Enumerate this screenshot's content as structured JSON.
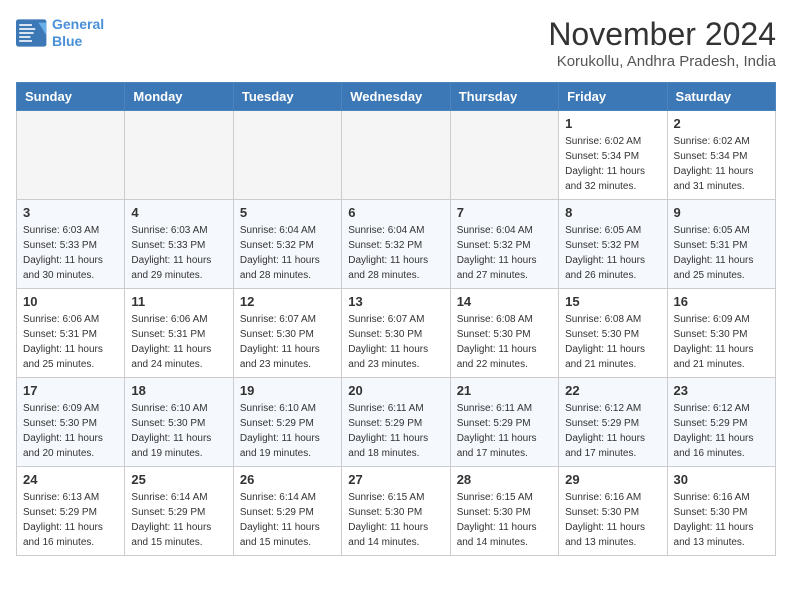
{
  "header": {
    "logo_line1": "General",
    "logo_line2": "Blue",
    "month": "November 2024",
    "location": "Korukollu, Andhra Pradesh, India"
  },
  "days_of_week": [
    "Sunday",
    "Monday",
    "Tuesday",
    "Wednesday",
    "Thursday",
    "Friday",
    "Saturday"
  ],
  "weeks": [
    [
      {
        "day": "",
        "info": ""
      },
      {
        "day": "",
        "info": ""
      },
      {
        "day": "",
        "info": ""
      },
      {
        "day": "",
        "info": ""
      },
      {
        "day": "",
        "info": ""
      },
      {
        "day": "1",
        "info": "Sunrise: 6:02 AM\nSunset: 5:34 PM\nDaylight: 11 hours and 32 minutes."
      },
      {
        "day": "2",
        "info": "Sunrise: 6:02 AM\nSunset: 5:34 PM\nDaylight: 11 hours and 31 minutes."
      }
    ],
    [
      {
        "day": "3",
        "info": "Sunrise: 6:03 AM\nSunset: 5:33 PM\nDaylight: 11 hours and 30 minutes."
      },
      {
        "day": "4",
        "info": "Sunrise: 6:03 AM\nSunset: 5:33 PM\nDaylight: 11 hours and 29 minutes."
      },
      {
        "day": "5",
        "info": "Sunrise: 6:04 AM\nSunset: 5:32 PM\nDaylight: 11 hours and 28 minutes."
      },
      {
        "day": "6",
        "info": "Sunrise: 6:04 AM\nSunset: 5:32 PM\nDaylight: 11 hours and 28 minutes."
      },
      {
        "day": "7",
        "info": "Sunrise: 6:04 AM\nSunset: 5:32 PM\nDaylight: 11 hours and 27 minutes."
      },
      {
        "day": "8",
        "info": "Sunrise: 6:05 AM\nSunset: 5:32 PM\nDaylight: 11 hours and 26 minutes."
      },
      {
        "day": "9",
        "info": "Sunrise: 6:05 AM\nSunset: 5:31 PM\nDaylight: 11 hours and 25 minutes."
      }
    ],
    [
      {
        "day": "10",
        "info": "Sunrise: 6:06 AM\nSunset: 5:31 PM\nDaylight: 11 hours and 25 minutes."
      },
      {
        "day": "11",
        "info": "Sunrise: 6:06 AM\nSunset: 5:31 PM\nDaylight: 11 hours and 24 minutes."
      },
      {
        "day": "12",
        "info": "Sunrise: 6:07 AM\nSunset: 5:30 PM\nDaylight: 11 hours and 23 minutes."
      },
      {
        "day": "13",
        "info": "Sunrise: 6:07 AM\nSunset: 5:30 PM\nDaylight: 11 hours and 23 minutes."
      },
      {
        "day": "14",
        "info": "Sunrise: 6:08 AM\nSunset: 5:30 PM\nDaylight: 11 hours and 22 minutes."
      },
      {
        "day": "15",
        "info": "Sunrise: 6:08 AM\nSunset: 5:30 PM\nDaylight: 11 hours and 21 minutes."
      },
      {
        "day": "16",
        "info": "Sunrise: 6:09 AM\nSunset: 5:30 PM\nDaylight: 11 hours and 21 minutes."
      }
    ],
    [
      {
        "day": "17",
        "info": "Sunrise: 6:09 AM\nSunset: 5:30 PM\nDaylight: 11 hours and 20 minutes."
      },
      {
        "day": "18",
        "info": "Sunrise: 6:10 AM\nSunset: 5:30 PM\nDaylight: 11 hours and 19 minutes."
      },
      {
        "day": "19",
        "info": "Sunrise: 6:10 AM\nSunset: 5:29 PM\nDaylight: 11 hours and 19 minutes."
      },
      {
        "day": "20",
        "info": "Sunrise: 6:11 AM\nSunset: 5:29 PM\nDaylight: 11 hours and 18 minutes."
      },
      {
        "day": "21",
        "info": "Sunrise: 6:11 AM\nSunset: 5:29 PM\nDaylight: 11 hours and 17 minutes."
      },
      {
        "day": "22",
        "info": "Sunrise: 6:12 AM\nSunset: 5:29 PM\nDaylight: 11 hours and 17 minutes."
      },
      {
        "day": "23",
        "info": "Sunrise: 6:12 AM\nSunset: 5:29 PM\nDaylight: 11 hours and 16 minutes."
      }
    ],
    [
      {
        "day": "24",
        "info": "Sunrise: 6:13 AM\nSunset: 5:29 PM\nDaylight: 11 hours and 16 minutes."
      },
      {
        "day": "25",
        "info": "Sunrise: 6:14 AM\nSunset: 5:29 PM\nDaylight: 11 hours and 15 minutes."
      },
      {
        "day": "26",
        "info": "Sunrise: 6:14 AM\nSunset: 5:29 PM\nDaylight: 11 hours and 15 minutes."
      },
      {
        "day": "27",
        "info": "Sunrise: 6:15 AM\nSunset: 5:30 PM\nDaylight: 11 hours and 14 minutes."
      },
      {
        "day": "28",
        "info": "Sunrise: 6:15 AM\nSunset: 5:30 PM\nDaylight: 11 hours and 14 minutes."
      },
      {
        "day": "29",
        "info": "Sunrise: 6:16 AM\nSunset: 5:30 PM\nDaylight: 11 hours and 13 minutes."
      },
      {
        "day": "30",
        "info": "Sunrise: 6:16 AM\nSunset: 5:30 PM\nDaylight: 11 hours and 13 minutes."
      }
    ]
  ]
}
